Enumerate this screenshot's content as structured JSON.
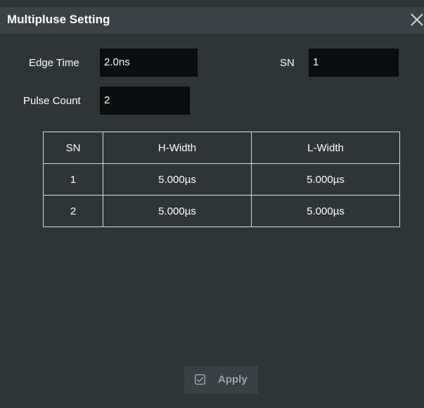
{
  "dialog": {
    "title": "Multipluse Setting",
    "close_icon": "close-icon"
  },
  "fields": {
    "edge_time": {
      "label": "Edge Time",
      "value": "2.0ns"
    },
    "sn": {
      "label": "SN",
      "value": "1"
    },
    "pulse_count": {
      "label": "Pulse Count",
      "value": "2"
    }
  },
  "table": {
    "headers": [
      "SN",
      "H-Width",
      "L-Width"
    ],
    "rows": [
      [
        "1",
        "5.000µs",
        "5.000µs"
      ],
      [
        "2",
        "5.000µs",
        "5.000µs"
      ]
    ]
  },
  "apply": {
    "label": "Apply",
    "icon": "checkbox-icon"
  },
  "colors": {
    "background": "#2f3537",
    "titlebar": "#3c4347",
    "input_background": "#0a0c0d",
    "table_border": "#d9dcdd"
  }
}
